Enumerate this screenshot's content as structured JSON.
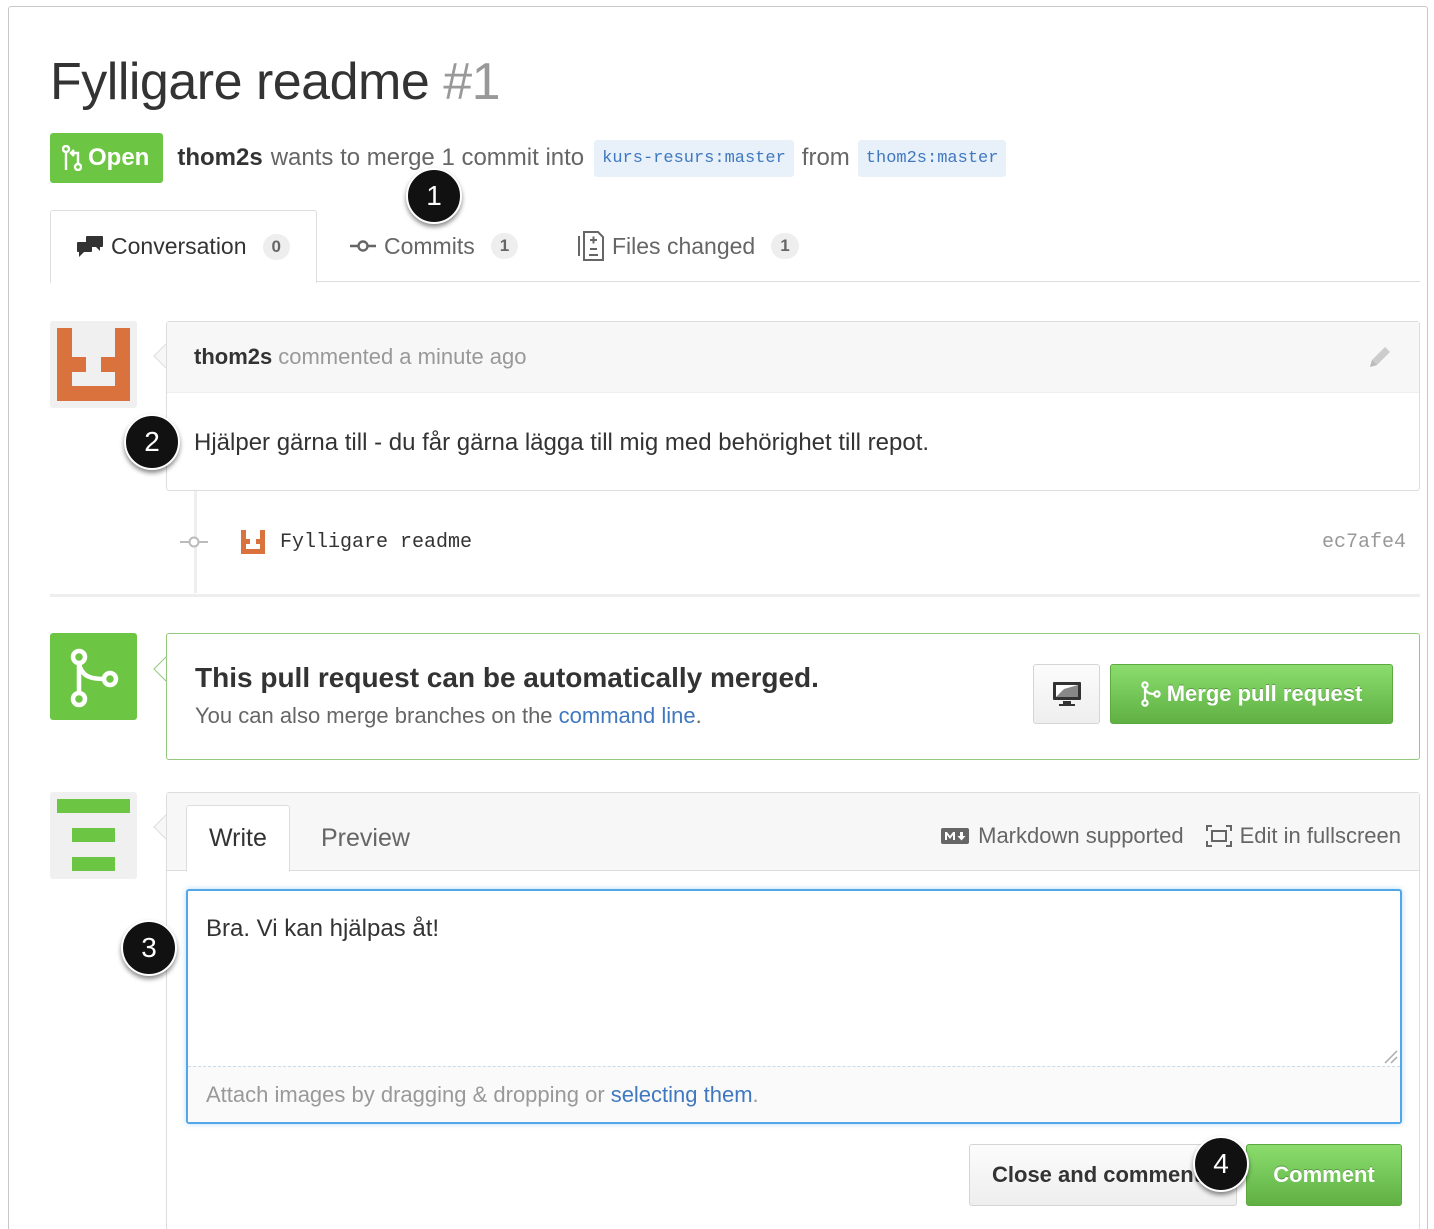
{
  "pull_request": {
    "title": "Fylligare readme",
    "number": "#1",
    "state": "Open",
    "author": "thom2s",
    "summary_part1": "wants to merge 1 commit into",
    "base_branch": "kurs-resurs:master",
    "from_word": "from",
    "head_branch": "thom2s:master"
  },
  "tabs": [
    {
      "label": "Conversation",
      "count": "0"
    },
    {
      "label": "Commits",
      "count": "1"
    },
    {
      "label": "Files changed",
      "count": "1"
    }
  ],
  "comment": {
    "author": "thom2s",
    "meta": "commented a minute ago",
    "body": "Hjälper gärna till - du får gärna lägga till mig med behörighet till repot."
  },
  "commit": {
    "message": "Fylligare readme",
    "sha": "ec7afe4"
  },
  "merge": {
    "title": "This pull request can be automatically merged.",
    "subtitle_prefix": "You can also merge branches on the",
    "subtitle_link": "command line",
    "subtitle_suffix": ".",
    "button_label": "Merge pull request"
  },
  "form": {
    "tab_write": "Write",
    "tab_preview": "Preview",
    "markdown_label": "Markdown supported",
    "fullscreen_label": "Edit in fullscreen",
    "text": "Bra. Vi kan hjälpas åt!",
    "attach_prefix": "Attach images by dragging & dropping or",
    "attach_link": "selecting them",
    "attach_suffix": ".",
    "close_button": "Close and comment",
    "comment_button": "Comment"
  },
  "markers": [
    "1",
    "2",
    "3",
    "4"
  ],
  "colors": {
    "open_green": "#6cc644",
    "link_blue": "#4078c0",
    "avatar_orange": "#d9723c",
    "avatar_green": "#6cc644"
  }
}
